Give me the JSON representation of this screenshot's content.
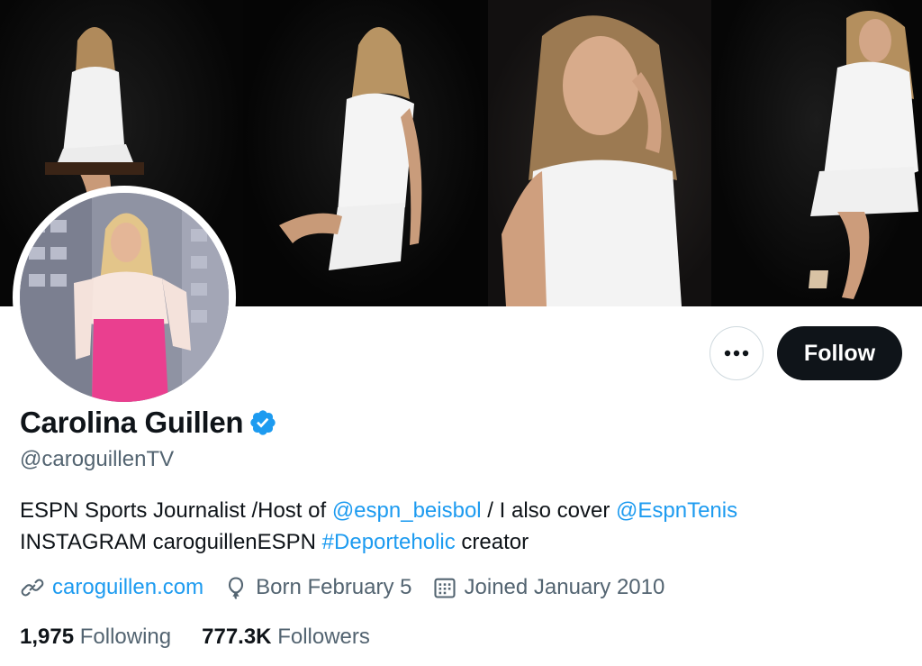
{
  "profile": {
    "display_name": "Carolina Guillen",
    "handle": "@caroguillenTV",
    "verified": true,
    "bio": {
      "line1_text1": "ESPN Sports Journalist /Host of ",
      "line1_mention1": "@espn_beisbol",
      "line1_text2": " / I also cover ",
      "line1_mention2": "@EspnTenis",
      "line2_text1": "INSTAGRAM caroguillenESPN ",
      "line2_hashtag": "#Deporteholic",
      "line2_text2": " creator"
    },
    "website": "caroguillen.com",
    "birthday": "Born February 5",
    "joined": "Joined January 2010",
    "following_count": "1,975",
    "following_label": "Following",
    "followers_count": "777.3K",
    "followers_label": "Followers"
  },
  "actions": {
    "follow_label": "Follow",
    "more_icon": "ellipsis-icon"
  },
  "colors": {
    "accent": "#1d9bf0",
    "text": "#0f1419",
    "muted": "#536471",
    "button_dark": "#0f1419"
  }
}
